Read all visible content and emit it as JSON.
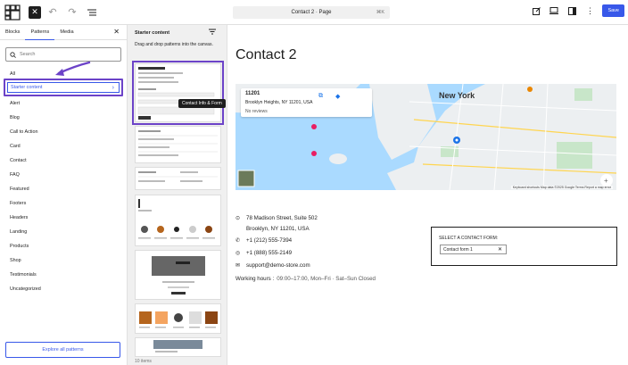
{
  "topbar": {
    "doc_title": "Contact 2 · Page",
    "shortcut": "⌘K",
    "save_label": "Save"
  },
  "left_panel": {
    "tabs": [
      "Blocks",
      "Patterns",
      "Media"
    ],
    "active_tab": "Patterns",
    "search_placeholder": "Search",
    "categories": [
      "All",
      "Starter content",
      "Alert",
      "Blog",
      "Call to Action",
      "Card",
      "Contact",
      "FAQ",
      "Featured",
      "Footers",
      "Headers",
      "Landing",
      "Products",
      "Shop",
      "Testimonials",
      "Uncategorized"
    ],
    "selected_category": "Starter content",
    "explore_label": "Explore all patterns"
  },
  "middle_panel": {
    "title": "Starter content",
    "description": "Drag and drop patterns into the canvas.",
    "tooltip": "Contact Info & Form",
    "count": "10 items"
  },
  "canvas": {
    "page_title": "Contact 2",
    "map": {
      "zip": "11201",
      "address": "Brooklyn Heights, NY 11201, USA",
      "reviews": "No reviews",
      "city_label": "New York",
      "credit": "Keyboard shortcuts   Map data ©2025 Google   Terms   Report a map error"
    },
    "contact": {
      "address_line1": "78 Madison Street, Suite 502",
      "address_line2": "Brooklyn, NY 11201, USA",
      "phone": "+1 (212) 555-7394",
      "whatsapp": "+1 (888) 555-2149",
      "email": "support@demo-store.com",
      "hours_label": "Working hours :",
      "hours_value": "09:00–17:00, Mon–Fri · Sat–Sun Closed"
    },
    "form": {
      "label": "SELECT A CONTACT FORM:",
      "selected": "Contact form 1"
    }
  },
  "colors": {
    "accent": "#3858e9",
    "highlight": "#6c43c8",
    "water": "#a8d8f0",
    "land": "#eceff1"
  }
}
